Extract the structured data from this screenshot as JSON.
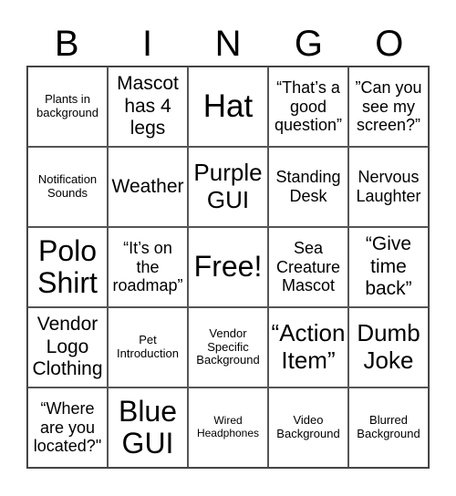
{
  "header": {
    "letters": [
      "B",
      "I",
      "N",
      "G",
      "O"
    ]
  },
  "cells": [
    {
      "text": "Plants in background",
      "size": "fs-sm"
    },
    {
      "text": "Mascot has 4 legs",
      "size": "fs-lg"
    },
    {
      "text": "Hat",
      "size": "fs-huge"
    },
    {
      "text": "“That’s a good question”",
      "size": "fs-md"
    },
    {
      "text": "”Can you see my screen?”",
      "size": "fs-md"
    },
    {
      "text": "Notification Sounds",
      "size": "fs-sm"
    },
    {
      "text": "Weather",
      "size": "fs-lg"
    },
    {
      "text": "Purple GUI",
      "size": "fs-xl"
    },
    {
      "text": "Standing Desk",
      "size": "fs-md"
    },
    {
      "text": "Nervous Laughter",
      "size": "fs-md"
    },
    {
      "text": "Polo Shirt",
      "size": "fs-xxl"
    },
    {
      "text": "“It’s on the roadmap”",
      "size": "fs-md"
    },
    {
      "text": "Free!",
      "size": "fs-xxl"
    },
    {
      "text": "Sea Creature Mascot",
      "size": "fs-md"
    },
    {
      "text": "“Give time back”",
      "size": "fs-lg"
    },
    {
      "text": "Vendor Logo Clothing",
      "size": "fs-lg"
    },
    {
      "text": "Pet Introduction",
      "size": "fs-sm"
    },
    {
      "text": "Vendor Specific Background",
      "size": "fs-sm"
    },
    {
      "text": "“Action Item”",
      "size": "fs-xl"
    },
    {
      "text": "Dumb Joke",
      "size": "fs-xl"
    },
    {
      "text": "“Where are you located?\"",
      "size": "fs-md"
    },
    {
      "text": "Blue GUI",
      "size": "fs-xxl"
    },
    {
      "text": "Wired Headphones",
      "size": "fs-xs"
    },
    {
      "text": "Video Background",
      "size": "fs-sm"
    },
    {
      "text": "Blurred Background",
      "size": "fs-sm"
    }
  ]
}
